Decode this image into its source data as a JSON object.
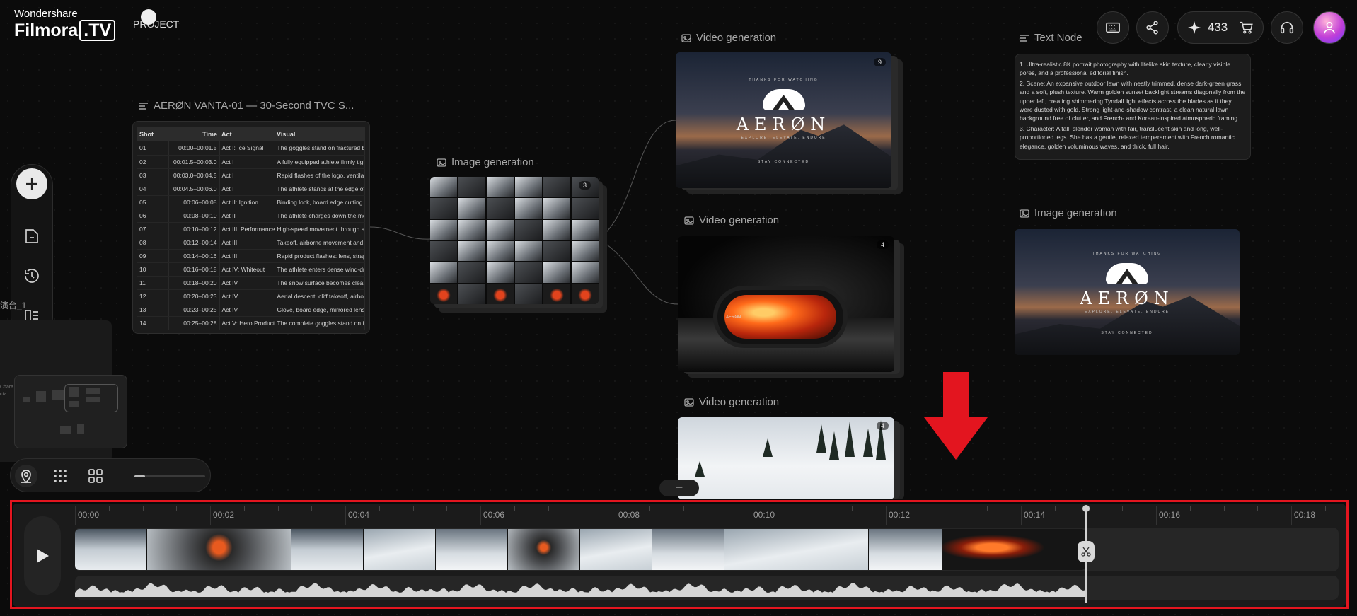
{
  "header": {
    "brand_top": "Wondershare",
    "brand_main": "Filmora",
    "brand_suffix": ".TV",
    "project_label": "PROJECT",
    "credits": "433"
  },
  "icons": {
    "keyboard": "keyboard-icon",
    "share": "share-icon",
    "credits": "sparkle-icon",
    "cart": "cart-icon",
    "support": "headset-icon",
    "avatar": "avatar-icon",
    "add": "plus-icon",
    "folder": "folder-icon",
    "history": "history-icon",
    "layout": "layout-icon",
    "locate": "location-icon",
    "grid": "grid-icon",
    "layout2": "layout-grid-icon",
    "play": "play-icon",
    "scissors": "scissors-icon"
  },
  "colors": {
    "accent_red": "#e3151f",
    "background": "#0b0b0b",
    "panel": "#1c1c1c"
  },
  "sidebar": {
    "side_tag": "演台_1",
    "side_text": "Chara cta"
  },
  "table_node": {
    "title": "AERØN VANTA-01 — 30-Second TVC S...",
    "columns": [
      "Shot",
      "Time",
      "Act",
      "Visual"
    ],
    "rows": [
      [
        "01",
        "00:00–00:01.5",
        "Act I: Ice Signal",
        "The goggles stand on fractured bla"
      ],
      [
        "02",
        "00:01.5–00:03.0",
        "Act I",
        "A fully equipped athlete firmly tight"
      ],
      [
        "03",
        "00:03.0–00:04.5",
        "Act I",
        "Rapid flashes of the logo, ventilatio"
      ],
      [
        "04",
        "00:04.5–00:06.0",
        "Act I",
        "The athlete stands at the edge of a"
      ],
      [
        "05",
        "00:06–00:08",
        "Act II: Ignition",
        "Binding lock, board edge cutting in"
      ],
      [
        "06",
        "00:08–00:10",
        "Act II",
        "The athlete charges down the mou"
      ],
      [
        "07",
        "00:10–00:12",
        "Act III: Performance",
        "High-speed movement through a s"
      ],
      [
        "08",
        "00:12–00:14",
        "Act III",
        "Takeoff, airborne movement and a t"
      ],
      [
        "09",
        "00:14–00:16",
        "Act III",
        "Rapid product flashes: lens, strap lo"
      ],
      [
        "10",
        "00:16–00:18",
        "Act IV: Whiteout",
        "The athlete enters dense wind-driv"
      ],
      [
        "11",
        "00:18–00:20",
        "Act IV",
        "The snow surface becomes clearly"
      ],
      [
        "12",
        "00:20–00:23",
        "Act IV",
        "Aerial descent, cliff takeoff, airborn"
      ],
      [
        "13",
        "00:23–00:25",
        "Act IV",
        "Glove, board edge, mirrored lens, n"
      ],
      [
        "14",
        "00:25–00:28",
        "Act V: Hero Product",
        "The complete goggles stand on fra"
      ]
    ]
  },
  "image_node_1": {
    "title": "Image generation",
    "badge": "3"
  },
  "video_nodes": [
    {
      "title": "Video generation",
      "badge": "9",
      "aeron_top": "THANKS FOR WATCHING",
      "aeron_word": "AERØN",
      "aeron_tag": "EXPLORE. ELEVATE. ENDURE",
      "aeron_foot": "STAY CONNECTED"
    },
    {
      "title": "Video generation",
      "badge": "4",
      "logo_word": "AERØN"
    },
    {
      "title": "Video generation",
      "badge": "4"
    }
  ],
  "text_node": {
    "title": "Text Node",
    "paragraphs": [
      "1. Ultra-realistic 8K portrait photography with lifelike skin texture, clearly visible pores, and a professional editorial finish.",
      "2. Scene: An expansive outdoor lawn with neatly trimmed, dense dark-green grass and a soft, plush texture. Warm golden sunset backlight streams diagonally from the upper left, creating shimmering Tyndall light effects across the blades as if they were dusted with gold. Strong light-and-shadow contrast, a clean natural lawn background free of clutter, and French- and Korean-inspired atmospheric framing.",
      "3. Character: A tall, slender woman with fair, translucent skin and long, well-proportioned legs. She has a gentle, relaxed temperament with French romantic elegance, golden voluminous waves, and thick, full hair."
    ]
  },
  "image_node_2": {
    "title": "Image generation",
    "aeron_top": "THANKS FOR WATCHING",
    "aeron_word": "AERØN",
    "aeron_tag": "EXPLORE. ELEVATE. ENDURE",
    "aeron_foot": "STAY CONNECTED"
  },
  "canvas": {
    "collapse_label": "–",
    "zoom_level": 0.15
  },
  "timeline": {
    "ruler": [
      "00:00",
      "00:02",
      "00:04",
      "00:06",
      "00:08",
      "00:10",
      "00:12",
      "00:14",
      "00:16",
      "00:18"
    ],
    "playhead_time": "00:15"
  }
}
